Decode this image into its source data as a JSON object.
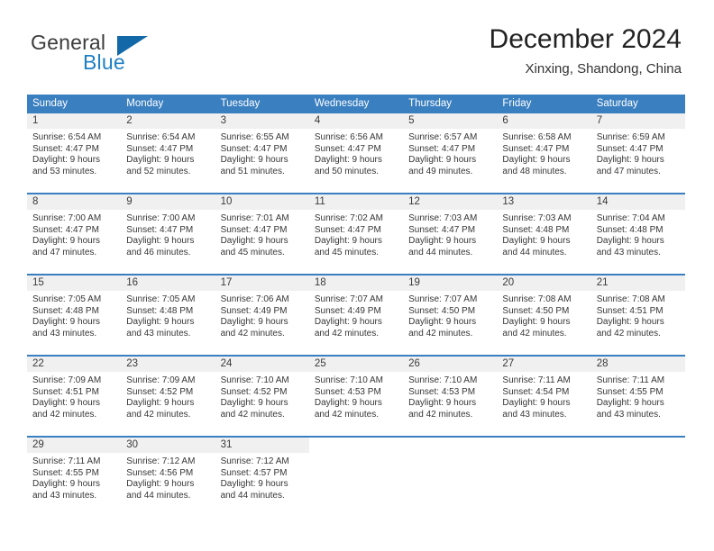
{
  "brand": {
    "name_part1": "General",
    "name_part2": "Blue",
    "flag_icon": "blue-triangle-flag-icon"
  },
  "header": {
    "title": "December 2024",
    "subtitle": "Xinxing, Shandong, China"
  },
  "colors": {
    "header_blue": "#3a7fc0",
    "brand_blue": "#1f7fc4",
    "flag_blue": "#1368a8",
    "day_band_gray": "#f0f0f0",
    "text_dark": "#363636"
  },
  "weekdays": [
    "Sunday",
    "Monday",
    "Tuesday",
    "Wednesday",
    "Thursday",
    "Friday",
    "Saturday"
  ],
  "weeks": [
    [
      {
        "day": "1",
        "sunrise": "Sunrise: 6:54 AM",
        "sunset": "Sunset: 4:47 PM",
        "daylight_line1": "Daylight: 9 hours",
        "daylight_line2": "and 53 minutes."
      },
      {
        "day": "2",
        "sunrise": "Sunrise: 6:54 AM",
        "sunset": "Sunset: 4:47 PM",
        "daylight_line1": "Daylight: 9 hours",
        "daylight_line2": "and 52 minutes."
      },
      {
        "day": "3",
        "sunrise": "Sunrise: 6:55 AM",
        "sunset": "Sunset: 4:47 PM",
        "daylight_line1": "Daylight: 9 hours",
        "daylight_line2": "and 51 minutes."
      },
      {
        "day": "4",
        "sunrise": "Sunrise: 6:56 AM",
        "sunset": "Sunset: 4:47 PM",
        "daylight_line1": "Daylight: 9 hours",
        "daylight_line2": "and 50 minutes."
      },
      {
        "day": "5",
        "sunrise": "Sunrise: 6:57 AM",
        "sunset": "Sunset: 4:47 PM",
        "daylight_line1": "Daylight: 9 hours",
        "daylight_line2": "and 49 minutes."
      },
      {
        "day": "6",
        "sunrise": "Sunrise: 6:58 AM",
        "sunset": "Sunset: 4:47 PM",
        "daylight_line1": "Daylight: 9 hours",
        "daylight_line2": "and 48 minutes."
      },
      {
        "day": "7",
        "sunrise": "Sunrise: 6:59 AM",
        "sunset": "Sunset: 4:47 PM",
        "daylight_line1": "Daylight: 9 hours",
        "daylight_line2": "and 47 minutes."
      }
    ],
    [
      {
        "day": "8",
        "sunrise": "Sunrise: 7:00 AM",
        "sunset": "Sunset: 4:47 PM",
        "daylight_line1": "Daylight: 9 hours",
        "daylight_line2": "and 47 minutes."
      },
      {
        "day": "9",
        "sunrise": "Sunrise: 7:00 AM",
        "sunset": "Sunset: 4:47 PM",
        "daylight_line1": "Daylight: 9 hours",
        "daylight_line2": "and 46 minutes."
      },
      {
        "day": "10",
        "sunrise": "Sunrise: 7:01 AM",
        "sunset": "Sunset: 4:47 PM",
        "daylight_line1": "Daylight: 9 hours",
        "daylight_line2": "and 45 minutes."
      },
      {
        "day": "11",
        "sunrise": "Sunrise: 7:02 AM",
        "sunset": "Sunset: 4:47 PM",
        "daylight_line1": "Daylight: 9 hours",
        "daylight_line2": "and 45 minutes."
      },
      {
        "day": "12",
        "sunrise": "Sunrise: 7:03 AM",
        "sunset": "Sunset: 4:47 PM",
        "daylight_line1": "Daylight: 9 hours",
        "daylight_line2": "and 44 minutes."
      },
      {
        "day": "13",
        "sunrise": "Sunrise: 7:03 AM",
        "sunset": "Sunset: 4:48 PM",
        "daylight_line1": "Daylight: 9 hours",
        "daylight_line2": "and 44 minutes."
      },
      {
        "day": "14",
        "sunrise": "Sunrise: 7:04 AM",
        "sunset": "Sunset: 4:48 PM",
        "daylight_line1": "Daylight: 9 hours",
        "daylight_line2": "and 43 minutes."
      }
    ],
    [
      {
        "day": "15",
        "sunrise": "Sunrise: 7:05 AM",
        "sunset": "Sunset: 4:48 PM",
        "daylight_line1": "Daylight: 9 hours",
        "daylight_line2": "and 43 minutes."
      },
      {
        "day": "16",
        "sunrise": "Sunrise: 7:05 AM",
        "sunset": "Sunset: 4:48 PM",
        "daylight_line1": "Daylight: 9 hours",
        "daylight_line2": "and 43 minutes."
      },
      {
        "day": "17",
        "sunrise": "Sunrise: 7:06 AM",
        "sunset": "Sunset: 4:49 PM",
        "daylight_line1": "Daylight: 9 hours",
        "daylight_line2": "and 42 minutes."
      },
      {
        "day": "18",
        "sunrise": "Sunrise: 7:07 AM",
        "sunset": "Sunset: 4:49 PM",
        "daylight_line1": "Daylight: 9 hours",
        "daylight_line2": "and 42 minutes."
      },
      {
        "day": "19",
        "sunrise": "Sunrise: 7:07 AM",
        "sunset": "Sunset: 4:50 PM",
        "daylight_line1": "Daylight: 9 hours",
        "daylight_line2": "and 42 minutes."
      },
      {
        "day": "20",
        "sunrise": "Sunrise: 7:08 AM",
        "sunset": "Sunset: 4:50 PM",
        "daylight_line1": "Daylight: 9 hours",
        "daylight_line2": "and 42 minutes."
      },
      {
        "day": "21",
        "sunrise": "Sunrise: 7:08 AM",
        "sunset": "Sunset: 4:51 PM",
        "daylight_line1": "Daylight: 9 hours",
        "daylight_line2": "and 42 minutes."
      }
    ],
    [
      {
        "day": "22",
        "sunrise": "Sunrise: 7:09 AM",
        "sunset": "Sunset: 4:51 PM",
        "daylight_line1": "Daylight: 9 hours",
        "daylight_line2": "and 42 minutes."
      },
      {
        "day": "23",
        "sunrise": "Sunrise: 7:09 AM",
        "sunset": "Sunset: 4:52 PM",
        "daylight_line1": "Daylight: 9 hours",
        "daylight_line2": "and 42 minutes."
      },
      {
        "day": "24",
        "sunrise": "Sunrise: 7:10 AM",
        "sunset": "Sunset: 4:52 PM",
        "daylight_line1": "Daylight: 9 hours",
        "daylight_line2": "and 42 minutes."
      },
      {
        "day": "25",
        "sunrise": "Sunrise: 7:10 AM",
        "sunset": "Sunset: 4:53 PM",
        "daylight_line1": "Daylight: 9 hours",
        "daylight_line2": "and 42 minutes."
      },
      {
        "day": "26",
        "sunrise": "Sunrise: 7:10 AM",
        "sunset": "Sunset: 4:53 PM",
        "daylight_line1": "Daylight: 9 hours",
        "daylight_line2": "and 42 minutes."
      },
      {
        "day": "27",
        "sunrise": "Sunrise: 7:11 AM",
        "sunset": "Sunset: 4:54 PM",
        "daylight_line1": "Daylight: 9 hours",
        "daylight_line2": "and 43 minutes."
      },
      {
        "day": "28",
        "sunrise": "Sunrise: 7:11 AM",
        "sunset": "Sunset: 4:55 PM",
        "daylight_line1": "Daylight: 9 hours",
        "daylight_line2": "and 43 minutes."
      }
    ],
    [
      {
        "day": "29",
        "sunrise": "Sunrise: 7:11 AM",
        "sunset": "Sunset: 4:55 PM",
        "daylight_line1": "Daylight: 9 hours",
        "daylight_line2": "and 43 minutes."
      },
      {
        "day": "30",
        "sunrise": "Sunrise: 7:12 AM",
        "sunset": "Sunset: 4:56 PM",
        "daylight_line1": "Daylight: 9 hours",
        "daylight_line2": "and 44 minutes."
      },
      {
        "day": "31",
        "sunrise": "Sunrise: 7:12 AM",
        "sunset": "Sunset: 4:57 PM",
        "daylight_line1": "Daylight: 9 hours",
        "daylight_line2": "and 44 minutes."
      },
      {
        "day": "",
        "sunrise": "",
        "sunset": "",
        "daylight_line1": "",
        "daylight_line2": ""
      },
      {
        "day": "",
        "sunrise": "",
        "sunset": "",
        "daylight_line1": "",
        "daylight_line2": ""
      },
      {
        "day": "",
        "sunrise": "",
        "sunset": "",
        "daylight_line1": "",
        "daylight_line2": ""
      },
      {
        "day": "",
        "sunrise": "",
        "sunset": "",
        "daylight_line1": "",
        "daylight_line2": ""
      }
    ]
  ]
}
